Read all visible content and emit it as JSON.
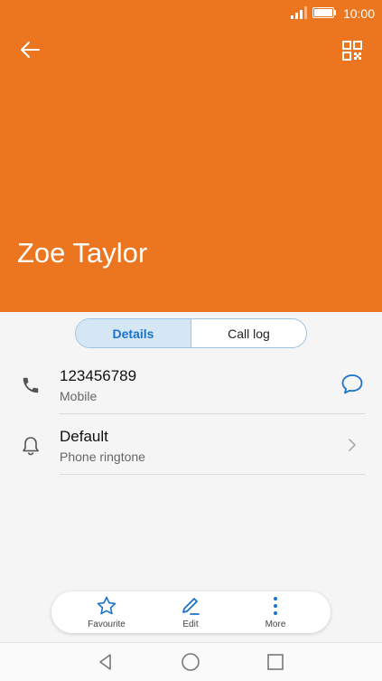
{
  "status_bar": {
    "time": "10:00"
  },
  "contact": {
    "name": "Zoe Taylor"
  },
  "tabs": [
    {
      "label": "Details",
      "active": true
    },
    {
      "label": "Call log",
      "active": false
    }
  ],
  "details": [
    {
      "primary": "123456789",
      "secondary": "Mobile",
      "icon": "phone-icon",
      "action_icon": "message-icon"
    },
    {
      "primary": "Default",
      "secondary": "Phone ringtone",
      "icon": "bell-icon",
      "action_icon": "chevron-right-icon"
    }
  ],
  "actions": [
    {
      "label": "Favourite",
      "icon": "star-icon"
    },
    {
      "label": "Edit",
      "icon": "pencil-icon"
    },
    {
      "label": "More",
      "icon": "more-vertical-icon"
    }
  ],
  "colors": {
    "header": "#ec7620",
    "accent": "#1a73c9",
    "tab_active_bg": "#d5e6f5"
  },
  "nav_bar": [
    "back-triangle-icon",
    "home-circle-icon",
    "recents-square-icon"
  ]
}
